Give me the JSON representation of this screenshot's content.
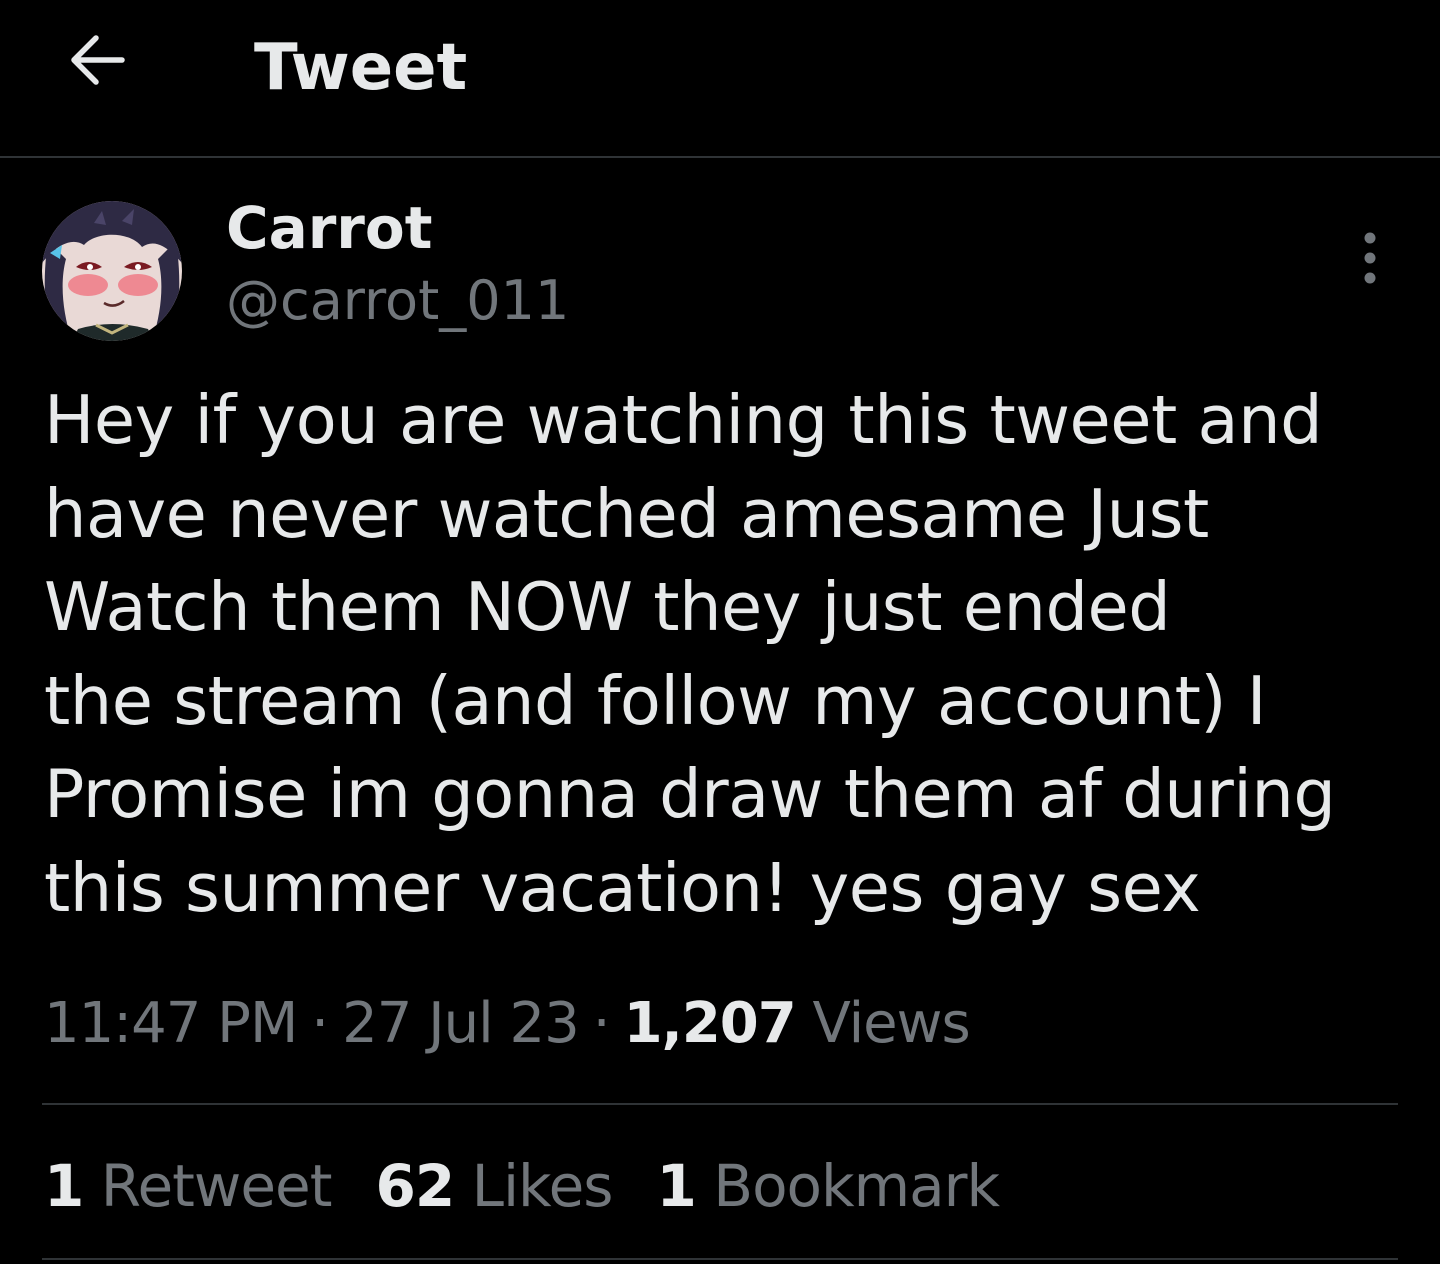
{
  "header": {
    "title": "Tweet",
    "back_icon": "arrow-left-icon"
  },
  "author": {
    "display_name": "Carrot",
    "handle": "@carrot_011",
    "avatar_icon": "avatar-anime-character"
  },
  "more_icon": "more-vertical-icon",
  "tweet": {
    "text": "Hey if you are watching this tweet and\nhave never watched amesame Just\nWatch them NOW they just ended\nthe stream (and follow my account) I\nPromise im gonna draw them af during\nthis summer vacation! yes gay sex"
  },
  "meta": {
    "time": "11:47 PM",
    "separator": "·",
    "date": "27 Jul 23",
    "views_count": "1,207",
    "views_label": "Views"
  },
  "stats": {
    "retweets_count": "1",
    "retweets_label": "Retweet",
    "likes_count": "62",
    "likes_label": "Likes",
    "bookmarks_count": "1",
    "bookmarks_label": "Bookmark"
  },
  "colors": {
    "background": "#000000",
    "text_primary": "#e7e9ea",
    "text_secondary": "#71767b",
    "divider": "#2f3336"
  }
}
